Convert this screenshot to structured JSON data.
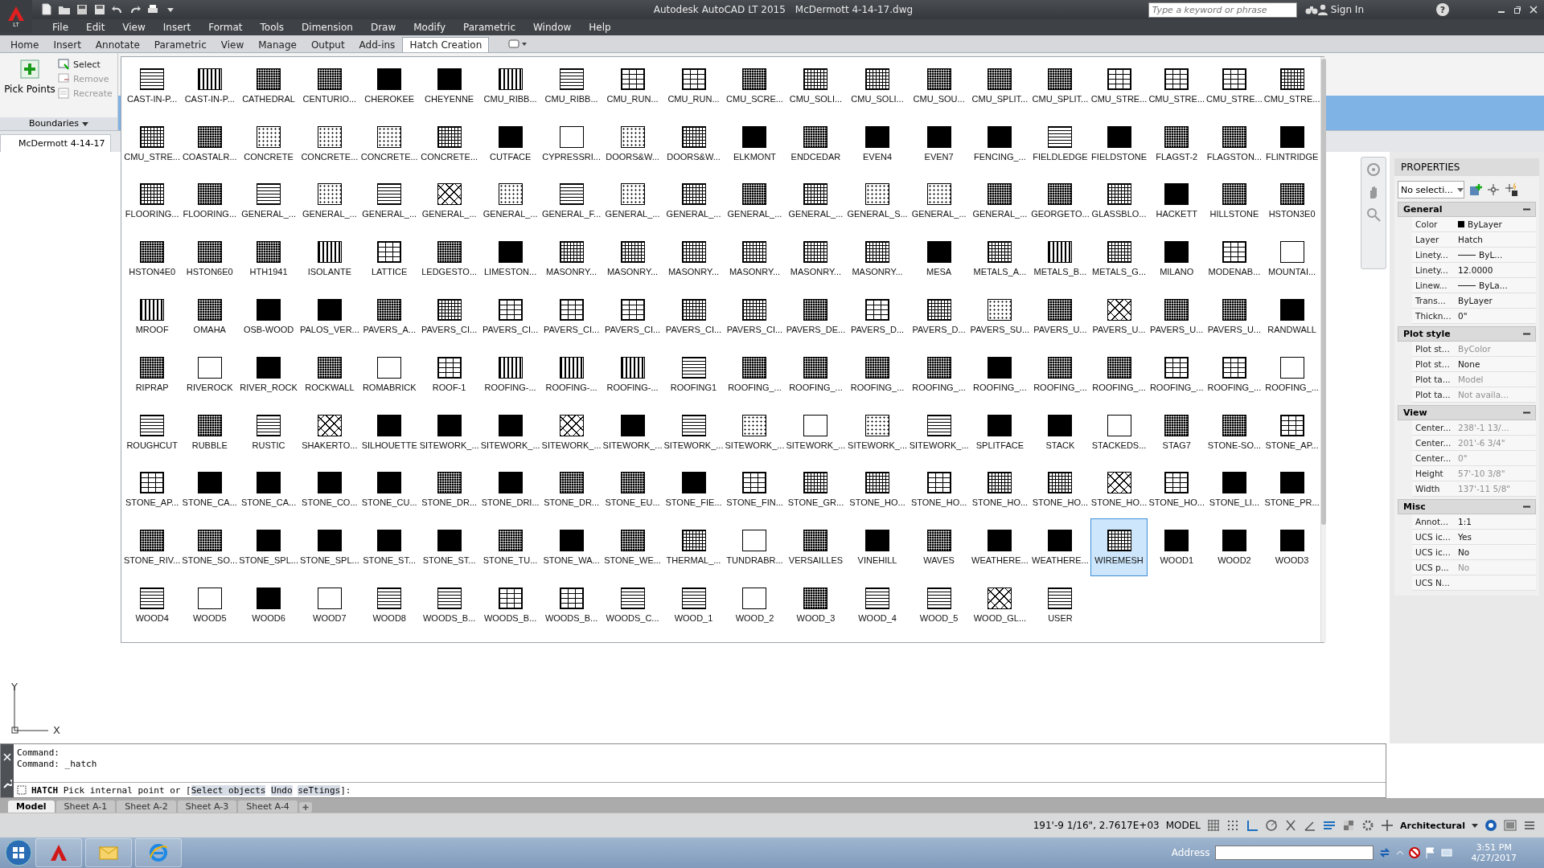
{
  "title_bar": {
    "edition": "LT",
    "title": "Autodesk AutoCAD LT 2015",
    "file": "McDermott 4-14-17.dwg",
    "search": {
      "placeholder": "Type a keyword or phrase"
    },
    "sign_in": "Sign In",
    "help": "?"
  },
  "menu": [
    "File",
    "Edit",
    "View",
    "Insert",
    "Format",
    "Tools",
    "Dimension",
    "Draw",
    "Modify",
    "Parametric",
    "Window",
    "Help"
  ],
  "ribbon": {
    "tabs": [
      {
        "label": "Home",
        "selected": false
      },
      {
        "label": "Insert",
        "selected": false
      },
      {
        "label": "Annotate",
        "selected": false
      },
      {
        "label": "Parametric",
        "selected": false
      },
      {
        "label": "View",
        "selected": false
      },
      {
        "label": "Manage",
        "selected": false
      },
      {
        "label": "Output",
        "selected": false
      },
      {
        "label": "Add-ins",
        "selected": false
      },
      {
        "label": "Hatch Creation",
        "selected": true
      }
    ],
    "panel": {
      "main_button": "Pick Points",
      "tools": [
        {
          "label": "Select",
          "disabled": false
        },
        {
          "label": "Remove",
          "disabled": true
        },
        {
          "label": "Recreate",
          "disabled": true
        }
      ],
      "title": "Boundaries"
    }
  },
  "file_tab": "McDermott 4-14-17",
  "hatch_gallery": {
    "patterns": [
      {
        "label": "CAST-IN-P...",
        "kind": "hlines",
        "selected": false
      },
      {
        "label": "CAST-IN-P...",
        "kind": "vlines",
        "selected": false
      },
      {
        "label": "CATHEDRAL",
        "kind": "dense",
        "selected": false
      },
      {
        "label": "CENTURIO...",
        "kind": "dense",
        "selected": false
      },
      {
        "label": "CHEROKEE",
        "kind": "solid",
        "selected": false
      },
      {
        "label": "CHEYENNE",
        "kind": "solid",
        "selected": false
      },
      {
        "label": "CMU_RIBB...",
        "kind": "vlines",
        "selected": false
      },
      {
        "label": "CMU_RIBB...",
        "kind": "hlines",
        "selected": false
      },
      {
        "label": "CMU_RUN...",
        "kind": "brick",
        "selected": false
      },
      {
        "label": "CMU_RUN...",
        "kind": "brick",
        "selected": false
      },
      {
        "label": "CMU_SCRE...",
        "kind": "dense",
        "selected": false
      },
      {
        "label": "CMU_SOLI...",
        "kind": "grid",
        "selected": false
      },
      {
        "label": "CMU_SOLI...",
        "kind": "grid",
        "selected": false
      },
      {
        "label": "CMU_SOU...",
        "kind": "dense",
        "selected": false
      },
      {
        "label": "CMU_SPLIT...",
        "kind": "dense",
        "selected": false
      },
      {
        "label": "CMU_SPLIT...",
        "kind": "dense",
        "selected": false
      },
      {
        "label": "CMU_STRE...",
        "kind": "brick",
        "selected": false
      },
      {
        "label": "CMU_STRE...",
        "kind": "brick",
        "selected": false
      },
      {
        "label": "CMU_STRE...",
        "kind": "brick",
        "selected": false
      },
      {
        "label": "CMU_STRE...",
        "kind": "grid",
        "selected": false
      },
      {
        "label": "CMU_STRE...",
        "kind": "grid",
        "selected": false
      },
      {
        "label": "COASTALR...",
        "kind": "dense",
        "selected": false
      },
      {
        "label": "CONCRETE",
        "kind": "dots",
        "selected": false
      },
      {
        "label": "CONCRETE...",
        "kind": "dots",
        "selected": false
      },
      {
        "label": "CONCRETE...",
        "kind": "dots",
        "selected": false
      },
      {
        "label": "CONCRETE...",
        "kind": "grid",
        "selected": false
      },
      {
        "label": "CUTFACE",
        "kind": "solid",
        "selected": false
      },
      {
        "label": "CYPRESSRI...",
        "kind": "blank",
        "selected": false
      },
      {
        "label": "DOORS&W...",
        "kind": "dots",
        "selected": false
      },
      {
        "label": "DOORS&W...",
        "kind": "grid",
        "selected": false
      },
      {
        "label": "ELKMONT",
        "kind": "solid",
        "selected": false
      },
      {
        "label": "ENDCEDAR",
        "kind": "dense",
        "selected": false
      },
      {
        "label": "EVEN4",
        "kind": "solid",
        "selected": false
      },
      {
        "label": "EVEN7",
        "kind": "solid",
        "selected": false
      },
      {
        "label": "FENCING_...",
        "kind": "solid",
        "selected": false
      },
      {
        "label": "FIELDLEDGE",
        "kind": "hlines",
        "selected": false
      },
      {
        "label": "FIELDSTONE",
        "kind": "solid",
        "selected": false
      },
      {
        "label": "FLAGST-2",
        "kind": "dense",
        "selected": false
      },
      {
        "label": "FLAGSTON...",
        "kind": "dense",
        "selected": false
      },
      {
        "label": "FLINTRIDGE",
        "kind": "solid",
        "selected": false
      },
      {
        "label": "FLOORING...",
        "kind": "grid",
        "selected": false
      },
      {
        "label": "FLOORING...",
        "kind": "dense",
        "selected": false
      },
      {
        "label": "GENERAL_...",
        "kind": "hlines",
        "selected": false
      },
      {
        "label": "GENERAL_...",
        "kind": "dots",
        "selected": false
      },
      {
        "label": "GENERAL_...",
        "kind": "hlines",
        "selected": false
      },
      {
        "label": "GENERAL_...",
        "kind": "cross",
        "selected": false
      },
      {
        "label": "GENERAL_...",
        "kind": "dots",
        "selected": false
      },
      {
        "label": "GENERAL_F...",
        "kind": "hlines",
        "selected": false
      },
      {
        "label": "GENERAL_...",
        "kind": "dots",
        "selected": false
      },
      {
        "label": "GENERAL_...",
        "kind": "grid",
        "selected": false
      },
      {
        "label": "GENERAL_...",
        "kind": "dense",
        "selected": false
      },
      {
        "label": "GENERAL_...",
        "kind": "grid",
        "selected": false
      },
      {
        "label": "GENERAL_S...",
        "kind": "dots",
        "selected": false
      },
      {
        "label": "GENERAL_...",
        "kind": "dots",
        "selected": false
      },
      {
        "label": "GENERAL_...",
        "kind": "dense",
        "selected": false
      },
      {
        "label": "GEORGETO...",
        "kind": "dense",
        "selected": false
      },
      {
        "label": "GLASSBLO...",
        "kind": "grid",
        "selected": false
      },
      {
        "label": "HACKETT",
        "kind": "solid",
        "selected": false
      },
      {
        "label": "HILLSTONE",
        "kind": "dense",
        "selected": false
      },
      {
        "label": "HSTON3E0",
        "kind": "dense",
        "selected": false
      },
      {
        "label": "HSTON4E0",
        "kind": "dense",
        "selected": false
      },
      {
        "label": "HSTON6E0",
        "kind": "dense",
        "selected": false
      },
      {
        "label": "HTH1941",
        "kind": "dense",
        "selected": false
      },
      {
        "label": "ISOLANTE",
        "kind": "vlines",
        "selected": false
      },
      {
        "label": "LATTICE",
        "kind": "brick",
        "selected": false
      },
      {
        "label": "LEDGESTO...",
        "kind": "dense",
        "selected": false
      },
      {
        "label": "LIMESTON...",
        "kind": "solid",
        "selected": false
      },
      {
        "label": "MASONRY...",
        "kind": "grid",
        "selected": false
      },
      {
        "label": "MASONRY...",
        "kind": "grid",
        "selected": false
      },
      {
        "label": "MASONRY...",
        "kind": "grid",
        "selected": false
      },
      {
        "label": "MASONRY...",
        "kind": "grid",
        "selected": false
      },
      {
        "label": "MASONRY...",
        "kind": "grid",
        "selected": false
      },
      {
        "label": "MASONRY...",
        "kind": "grid",
        "selected": false
      },
      {
        "label": "MESA",
        "kind": "solid",
        "selected": false
      },
      {
        "label": "METALS_A...",
        "kind": "grid",
        "selected": false
      },
      {
        "label": "METALS_B...",
        "kind": "vlines",
        "selected": false
      },
      {
        "label": "METALS_G...",
        "kind": "grid",
        "selected": false
      },
      {
        "label": "MILANO",
        "kind": "solid",
        "selected": false
      },
      {
        "label": "MODENAB...",
        "kind": "brick",
        "selected": false
      },
      {
        "label": "MOUNTAI...",
        "kind": "blank",
        "selected": false
      },
      {
        "label": "MROOF",
        "kind": "vlines",
        "selected": false
      },
      {
        "label": "OMAHA",
        "kind": "dense",
        "selected": false
      },
      {
        "label": "OSB-WOOD",
        "kind": "solid",
        "selected": false
      },
      {
        "label": "PALOS_VER...",
        "kind": "solid",
        "selected": false
      },
      {
        "label": "PAVERS_A...",
        "kind": "dense",
        "selected": false
      },
      {
        "label": "PAVERS_CI...",
        "kind": "grid",
        "selected": false
      },
      {
        "label": "PAVERS_CI...",
        "kind": "brick",
        "selected": false
      },
      {
        "label": "PAVERS_CI...",
        "kind": "brick",
        "selected": false
      },
      {
        "label": "PAVERS_CI...",
        "kind": "brick",
        "selected": false
      },
      {
        "label": "PAVERS_CI...",
        "kind": "grid",
        "selected": false
      },
      {
        "label": "PAVERS_CI...",
        "kind": "grid",
        "selected": false
      },
      {
        "label": "PAVERS_DE...",
        "kind": "dense",
        "selected": false
      },
      {
        "label": "PAVERS_D...",
        "kind": "brick",
        "selected": false
      },
      {
        "label": "PAVERS_D...",
        "kind": "grid",
        "selected": false
      },
      {
        "label": "PAVERS_SU...",
        "kind": "dots",
        "selected": false
      },
      {
        "label": "PAVERS_U...",
        "kind": "dense",
        "selected": false
      },
      {
        "label": "PAVERS_U...",
        "kind": "cross",
        "selected": false
      },
      {
        "label": "PAVERS_U...",
        "kind": "dense",
        "selected": false
      },
      {
        "label": "PAVERS_U...",
        "kind": "dense",
        "selected": false
      },
      {
        "label": "RANDWALL",
        "kind": "solid",
        "selected": false
      },
      {
        "label": "RIPRAP",
        "kind": "dense",
        "selected": false
      },
      {
        "label": "RIVEROCK",
        "kind": "blank",
        "selected": false
      },
      {
        "label": "RIVER_ROCK",
        "kind": "solid",
        "selected": false
      },
      {
        "label": "ROCKWALL",
        "kind": "dense",
        "selected": false
      },
      {
        "label": "ROMABRICK",
        "kind": "blank",
        "selected": false
      },
      {
        "label": "ROOF-1",
        "kind": "brick",
        "selected": false
      },
      {
        "label": "ROOFING-...",
        "kind": "vlines",
        "selected": false
      },
      {
        "label": "ROOFING-...",
        "kind": "vlines",
        "selected": false
      },
      {
        "label": "ROOFING-...",
        "kind": "vlines",
        "selected": false
      },
      {
        "label": "ROOFING1",
        "kind": "hlines",
        "selected": false
      },
      {
        "label": "ROOFING_...",
        "kind": "dense",
        "selected": false
      },
      {
        "label": "ROOFING_...",
        "kind": "dense",
        "selected": false
      },
      {
        "label": "ROOFING_...",
        "kind": "dense",
        "selected": false
      },
      {
        "label": "ROOFING_...",
        "kind": "dense",
        "selected": false
      },
      {
        "label": "ROOFING_...",
        "kind": "solid",
        "selected": false
      },
      {
        "label": "ROOFING_...",
        "kind": "dense",
        "selected": false
      },
      {
        "label": "ROOFING_...",
        "kind": "dense",
        "selected": false
      },
      {
        "label": "ROOFING_...",
        "kind": "brick",
        "selected": false
      },
      {
        "label": "ROOFING_...",
        "kind": "brick",
        "selected": false
      },
      {
        "label": "ROOFING_...",
        "kind": "blank",
        "selected": false
      },
      {
        "label": "ROUGHCUT",
        "kind": "hlines",
        "selected": false
      },
      {
        "label": "RUBBLE",
        "kind": "dense",
        "selected": false
      },
      {
        "label": "RUSTIC",
        "kind": "hlines",
        "selected": false
      },
      {
        "label": "SHAKERTO...",
        "kind": "cross",
        "selected": false
      },
      {
        "label": "SILHOUETTE",
        "kind": "solid",
        "selected": false
      },
      {
        "label": "SITEWORK_...",
        "kind": "solid",
        "selected": false
      },
      {
        "label": "SITEWORK_...",
        "kind": "solid",
        "selected": false
      },
      {
        "label": "SITEWORK_...",
        "kind": "cross",
        "selected": false
      },
      {
        "label": "SITEWORK_...",
        "kind": "solid",
        "selected": false
      },
      {
        "label": "SITEWORK_...",
        "kind": "hlines",
        "selected": false
      },
      {
        "label": "SITEWORK_...",
        "kind": "dots",
        "selected": false
      },
      {
        "label": "SITEWORK_...",
        "kind": "blank",
        "selected": false
      },
      {
        "label": "SITEWORK_...",
        "kind": "dots",
        "selected": false
      },
      {
        "label": "SITEWORK_...",
        "kind": "hlines",
        "selected": false
      },
      {
        "label": "SPLITFACE",
        "kind": "solid",
        "selected": false
      },
      {
        "label": "STACK",
        "kind": "solid",
        "selected": false
      },
      {
        "label": "STACKEDS...",
        "kind": "blank",
        "selected": false
      },
      {
        "label": "STAG7",
        "kind": "dense",
        "selected": false
      },
      {
        "label": "STONE-SO...",
        "kind": "dense",
        "selected": false
      },
      {
        "label": "STONE_AP...",
        "kind": "brick",
        "selected": false
      },
      {
        "label": "STONE_AP...",
        "kind": "brick",
        "selected": false
      },
      {
        "label": "STONE_CA...",
        "kind": "solid",
        "selected": false
      },
      {
        "label": "STONE_CA...",
        "kind": "solid",
        "selected": false
      },
      {
        "label": "STONE_CO...",
        "kind": "solid",
        "selected": false
      },
      {
        "label": "STONE_CU...",
        "kind": "solid",
        "selected": false
      },
      {
        "label": "STONE_DR...",
        "kind": "dense",
        "selected": false
      },
      {
        "label": "STONE_DRI...",
        "kind": "solid",
        "selected": false
      },
      {
        "label": "STONE_DR...",
        "kind": "dense",
        "selected": false
      },
      {
        "label": "STONE_EU...",
        "kind": "dense",
        "selected": false
      },
      {
        "label": "STONE_FIE...",
        "kind": "solid",
        "selected": false
      },
      {
        "label": "STONE_FIN...",
        "kind": "brick",
        "selected": false
      },
      {
        "label": "STONE_GR...",
        "kind": "grid",
        "selected": false
      },
      {
        "label": "STONE_HO...",
        "kind": "grid",
        "selected": false
      },
      {
        "label": "STONE_HO...",
        "kind": "brick",
        "selected": false
      },
      {
        "label": "STONE_HO...",
        "kind": "grid",
        "selected": false
      },
      {
        "label": "STONE_HO...",
        "kind": "grid",
        "selected": false
      },
      {
        "label": "STONE_HO...",
        "kind": "cross",
        "selected": false
      },
      {
        "label": "STONE_HO...",
        "kind": "brick",
        "selected": false
      },
      {
        "label": "STONE_LI...",
        "kind": "solid",
        "selected": false
      },
      {
        "label": "STONE_PR...",
        "kind": "solid",
        "selected": false
      },
      {
        "label": "STONE_RIV...",
        "kind": "dense",
        "selected": false
      },
      {
        "label": "STONE_SO...",
        "kind": "dense",
        "selected": false
      },
      {
        "label": "STONE_SPL...",
        "kind": "solid",
        "selected": false
      },
      {
        "label": "STONE_SPL...",
        "kind": "solid",
        "selected": false
      },
      {
        "label": "STONE_ST...",
        "kind": "solid",
        "selected": false
      },
      {
        "label": "STONE_ST...",
        "kind": "solid",
        "selected": false
      },
      {
        "label": "STONE_TU...",
        "kind": "dense",
        "selected": false
      },
      {
        "label": "STONE_WA...",
        "kind": "solid",
        "selected": false
      },
      {
        "label": "STONE_WE...",
        "kind": "dense",
        "selected": false
      },
      {
        "label": "THERMAL_...",
        "kind": "grid",
        "selected": false
      },
      {
        "label": "TUNDRABR...",
        "kind": "blank",
        "selected": false
      },
      {
        "label": "VERSAILLES",
        "kind": "dense",
        "selected": false
      },
      {
        "label": "VINEHILL",
        "kind": "solid",
        "selected": false
      },
      {
        "label": "WAVES",
        "kind": "dense",
        "selected": false
      },
      {
        "label": "WEATHERE...",
        "kind": "solid",
        "selected": false
      },
      {
        "label": "WEATHERE...",
        "kind": "solid",
        "selected": false
      },
      {
        "label": "WIREMESH",
        "kind": "grid",
        "selected": true
      },
      {
        "label": "WOOD1",
        "kind": "solid",
        "selected": false
      },
      {
        "label": "WOOD2",
        "kind": "solid",
        "selected": false
      },
      {
        "label": "WOOD3",
        "kind": "solid",
        "selected": false
      },
      {
        "label": "WOOD4",
        "kind": "hlines",
        "selected": false
      },
      {
        "label": "WOOD5",
        "kind": "blank",
        "selected": false
      },
      {
        "label": "WOOD6",
        "kind": "solid",
        "selected": false
      },
      {
        "label": "WOOD7",
        "kind": "blank",
        "selected": false
      },
      {
        "label": "WOOD8",
        "kind": "hlines",
        "selected": false
      },
      {
        "label": "WOODS_B...",
        "kind": "hlines",
        "selected": false
      },
      {
        "label": "WOODS_B...",
        "kind": "brick",
        "selected": false
      },
      {
        "label": "WOODS_B...",
        "kind": "brick",
        "selected": false
      },
      {
        "label": "WOODS_C...",
        "kind": "hlines",
        "selected": false
      },
      {
        "label": "WOOD_1",
        "kind": "hlines",
        "selected": false
      },
      {
        "label": "WOOD_2",
        "kind": "blank",
        "selected": false
      },
      {
        "label": "WOOD_3",
        "kind": "dense",
        "selected": false
      },
      {
        "label": "WOOD_4",
        "kind": "hlines",
        "selected": false
      },
      {
        "label": "WOOD_5",
        "kind": "hlines",
        "selected": false
      },
      {
        "label": "WOOD_GL...",
        "kind": "cross",
        "selected": false
      },
      {
        "label": "USER",
        "kind": "hlines",
        "selected": false
      }
    ]
  },
  "ucs": {
    "y": "Y",
    "x": "X"
  },
  "properties": {
    "title": "PROPERTIES",
    "selection": "No selecti...",
    "sections": [
      {
        "title": "General",
        "expanded": true,
        "rows": [
          {
            "label": "Color",
            "value": "ByLayer",
            "kind": "swatch",
            "disabled": false
          },
          {
            "label": "Layer",
            "value": "Hatch",
            "kind": "text",
            "disabled": false
          },
          {
            "label": "Linety...",
            "value": "ByL...",
            "kind": "line",
            "disabled": false
          },
          {
            "label": "Linety...",
            "value": "12.0000",
            "kind": "text",
            "disabled": false
          },
          {
            "label": "Linew...",
            "value": "ByLa...",
            "kind": "line",
            "disabled": false
          },
          {
            "label": "Trans...",
            "value": "ByLayer",
            "kind": "text",
            "disabled": false
          },
          {
            "label": "Thickn...",
            "value": "0\"",
            "kind": "text",
            "disabled": false
          }
        ]
      },
      {
        "title": "Plot style",
        "expanded": true,
        "rows": [
          {
            "label": "Plot st...",
            "value": "ByColor",
            "kind": "text",
            "disabled": true
          },
          {
            "label": "Plot st...",
            "value": "None",
            "kind": "text",
            "disabled": false
          },
          {
            "label": "Plot ta...",
            "value": "Model",
            "kind": "text",
            "disabled": true
          },
          {
            "label": "Plot ta...",
            "value": "Not availa...",
            "kind": "text",
            "disabled": true
          }
        ]
      },
      {
        "title": "View",
        "expanded": true,
        "rows": [
          {
            "label": "Center...",
            "value": "238'-1 13/...",
            "kind": "text",
            "disabled": true
          },
          {
            "label": "Center...",
            "value": "201'-6 3/4\"",
            "kind": "text",
            "disabled": true
          },
          {
            "label": "Center...",
            "value": "0\"",
            "kind": "text",
            "disabled": true
          },
          {
            "label": "Height",
            "value": "57'-10 3/8\"",
            "kind": "text",
            "disabled": true
          },
          {
            "label": "Width",
            "value": "137'-11 5/8\"",
            "kind": "text",
            "disabled": true
          }
        ]
      },
      {
        "title": "Misc",
        "expanded": true,
        "rows": [
          {
            "label": "Annot...",
            "value": "1:1",
            "kind": "text",
            "disabled": false
          },
          {
            "label": "UCS ic...",
            "value": "Yes",
            "kind": "text",
            "disabled": false
          },
          {
            "label": "UCS ic...",
            "value": "No",
            "kind": "text",
            "disabled": false
          },
          {
            "label": "UCS p...",
            "value": "No",
            "kind": "text",
            "disabled": true
          },
          {
            "label": "UCS N...",
            "kind": "text"
          }
        ]
      }
    ]
  },
  "command_line": {
    "history": [
      "Command:",
      "Command: _hatch"
    ],
    "prompt_start": "**HATCH** Pick internal point or [",
    "options": [
      "Select objects",
      "Undo",
      "seTtings"
    ],
    "prompt_end": "]:"
  },
  "layout_tabs": [
    {
      "label": "Model",
      "selected": true
    },
    {
      "label": "Sheet A-1",
      "selected": false
    },
    {
      "label": "Sheet A-2",
      "selected": false
    },
    {
      "label": "Sheet A-3",
      "selected": false
    },
    {
      "label": "Sheet A-4",
      "selected": false
    }
  ],
  "status_bar": {
    "coordinates": "191'-9 1/16\", 2.7617E+03",
    "space": "MODEL",
    "units": "Architectural"
  },
  "taskbar": {
    "address_label": "Address",
    "time": "3:51 PM",
    "date": "4/27/2017"
  }
}
